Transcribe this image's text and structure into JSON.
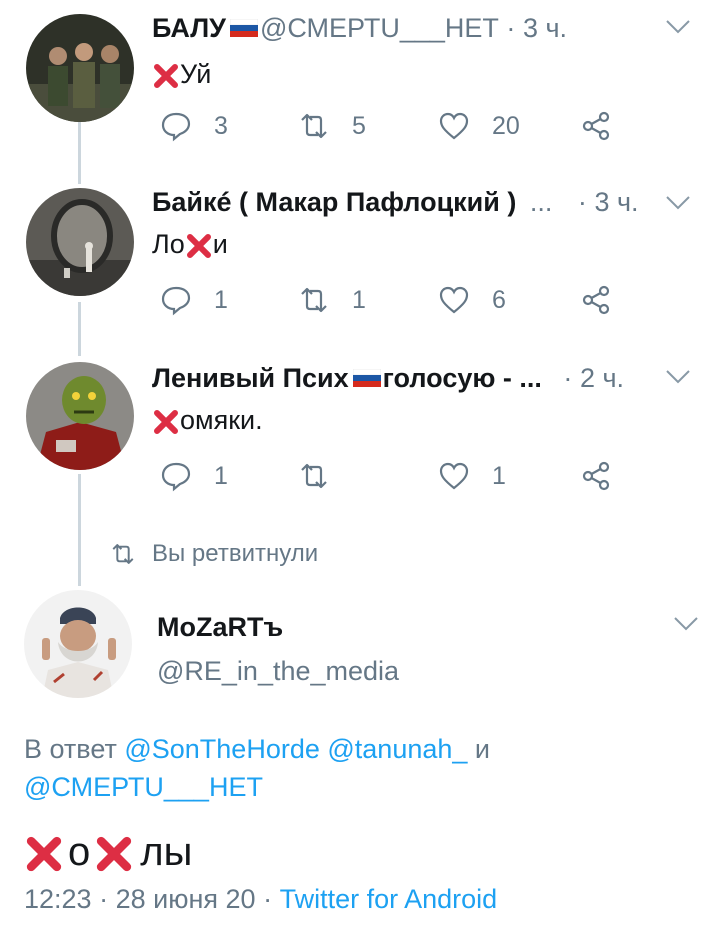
{
  "tweets": [
    {
      "name": "БАЛУ",
      "handle": "@СМЕРТU___НЕТ",
      "sep": "·",
      "time": "3 ч.",
      "text": "Уй",
      "text_before": "",
      "replies": "3",
      "retweets": "5",
      "likes": "20"
    },
    {
      "name": "Байкé ( Макар Пафлоцкий )",
      "ellipsis": "...",
      "sep": "·",
      "time": "3 ч.",
      "text_before": "Ло",
      "text": "и",
      "replies": "1",
      "retweets": "1",
      "likes": "6"
    },
    {
      "name": "Ленивый Псих",
      "name_suffix": "голосую - ...",
      "sep": "·",
      "time": "2 ч.",
      "text_before": "",
      "text": "омяки.",
      "replies": "1",
      "retweets": "",
      "likes": "1"
    }
  ],
  "retweeted_label": "Вы ретвитнули",
  "main_tweet": {
    "name": "MoZaRTъ",
    "handle": "@RE_in_the_media",
    "reply_prefix": "В ответ",
    "reply_user1": "@SonTheHorde",
    "reply_user2": "@tanunah_",
    "reply_and": "и",
    "reply_user3": "@СМЕРТU___НЕТ",
    "text_mid": "о",
    "text_end": "лы",
    "time": "12:23",
    "date": "28 июня 20",
    "sep": "·",
    "client": "Twitter for Android"
  },
  "colors": {
    "accent": "#1da1f2",
    "secondary_text": "#657786",
    "thread_line": "#ccd6dd",
    "cross": "#dd2e44"
  },
  "icons": [
    "reply-icon",
    "retweet-icon",
    "like-icon",
    "share-icon",
    "chevron-down-icon",
    "cross-mark-icon",
    "russia-flag-icon"
  ]
}
